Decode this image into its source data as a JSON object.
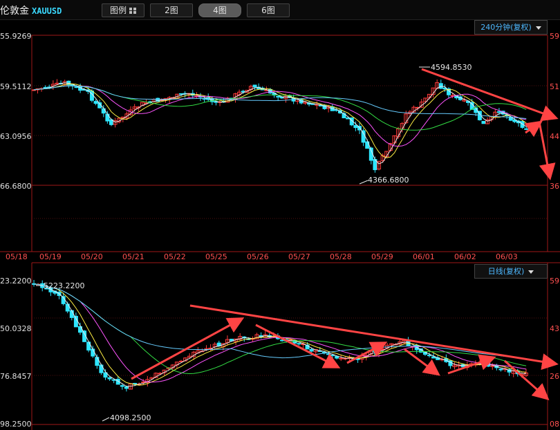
{
  "toolbar": {
    "title": "伦敦金",
    "symbol": "XAUUSD",
    "layout_label": "图例",
    "btn_2": "2图",
    "btn_4": "4图",
    "btn_6": "6图"
  },
  "upper_panel": {
    "period_label": "240分钟(复权)",
    "left_price_labels": [
      "55.9269",
      "59.5112",
      "63.0956",
      "66.6800"
    ],
    "right_labels": [
      "59",
      "51",
      "44",
      "36"
    ],
    "date_labels": [
      "05/18",
      "05/19",
      "05/20",
      "05/21",
      "05/22",
      "05/25",
      "05/26",
      "05/27",
      "05/28",
      "05/29",
      "06/01",
      "06/02",
      "06/03"
    ],
    "high_annotation": "4594.8530",
    "low_annotation": "4366.6800"
  },
  "lower_panel": {
    "period_label": "日线(复权)",
    "left_price_labels": [
      "23.2200",
      "50.0328",
      "76.8457",
      "98.2500"
    ],
    "right_labels": [
      "59",
      "43",
      "26",
      "08"
    ],
    "high_annotation": "5223.2200",
    "low_annotation": "4098.2500"
  },
  "colors": {
    "bull": "#ff3b3b",
    "bear": "#2ee6ff",
    "ma_white": "#e8e8e8",
    "ma_yellow": "#ffee44",
    "ma_magenta": "#ff55ff",
    "ma_green": "#33dd44",
    "ma_sky": "#66ccff",
    "arrow": "#ff4444",
    "border": "#a01818"
  }
}
